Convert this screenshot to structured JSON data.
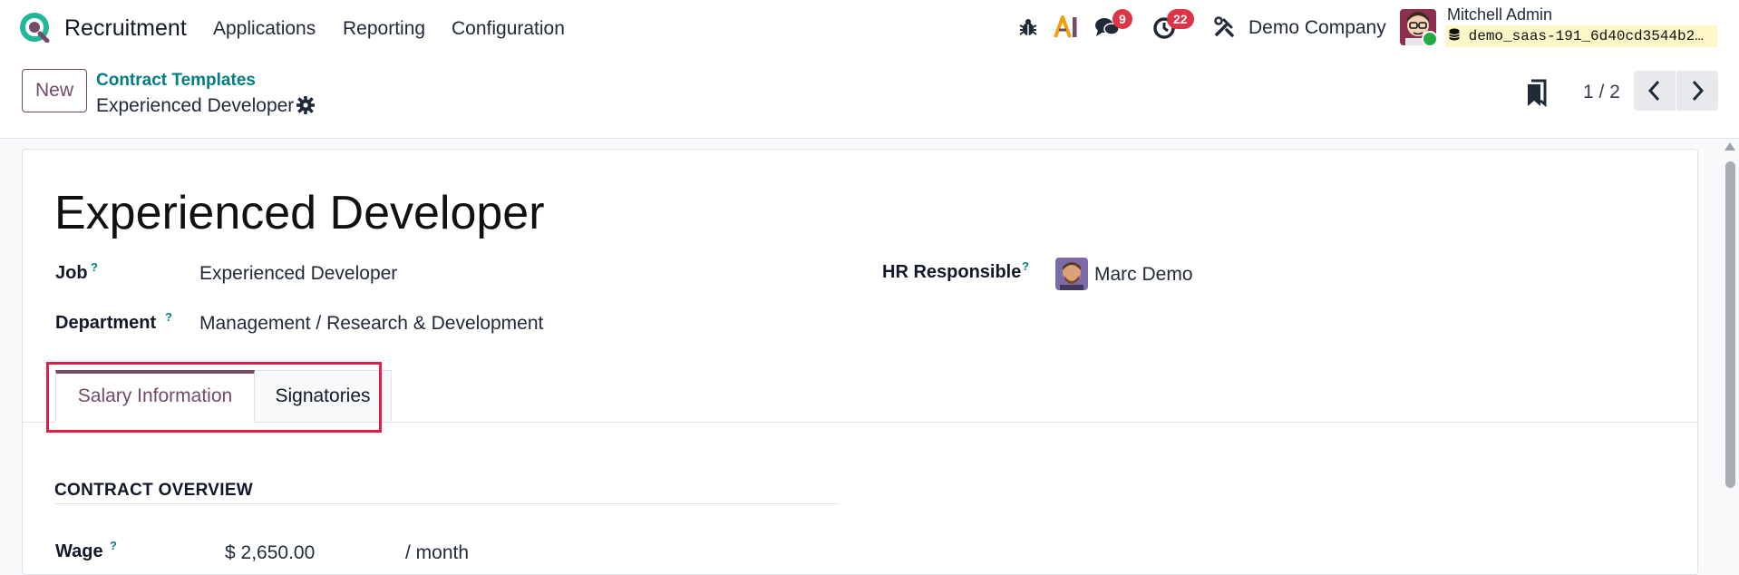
{
  "navbar": {
    "app_name": "Recruitment",
    "menus": [
      "Applications",
      "Reporting",
      "Configuration"
    ],
    "messages_count": "9",
    "activities_count": "22",
    "company": "Demo Company",
    "user_name": "Mitchell Admin",
    "database": "demo_saas-191_6d40cd3544b2…",
    "brand_color": "#714b67",
    "accent_color": "#017e84",
    "badge_color": "#dc3545"
  },
  "control_panel": {
    "new_label": "New",
    "breadcrumb_parent": "Contract Templates",
    "breadcrumb_current": "Experienced Developer",
    "pager": "1 / 2"
  },
  "record": {
    "title": "Experienced Developer",
    "job_label": "Job",
    "job_value": "Experienced Developer",
    "department_label": "Department",
    "department_value": "Management / Research & Development",
    "hr_label": "HR Responsible",
    "hr_value": "Marc Demo",
    "help_mark": "?"
  },
  "tabs": [
    {
      "label": "Salary Information",
      "active": true
    },
    {
      "label": "Signatories",
      "active": false
    }
  ],
  "salary": {
    "section_title": "CONTRACT OVERVIEW",
    "wage_label": "Wage",
    "wage_value": "$ 2,650.00",
    "wage_unit": "/ month"
  }
}
